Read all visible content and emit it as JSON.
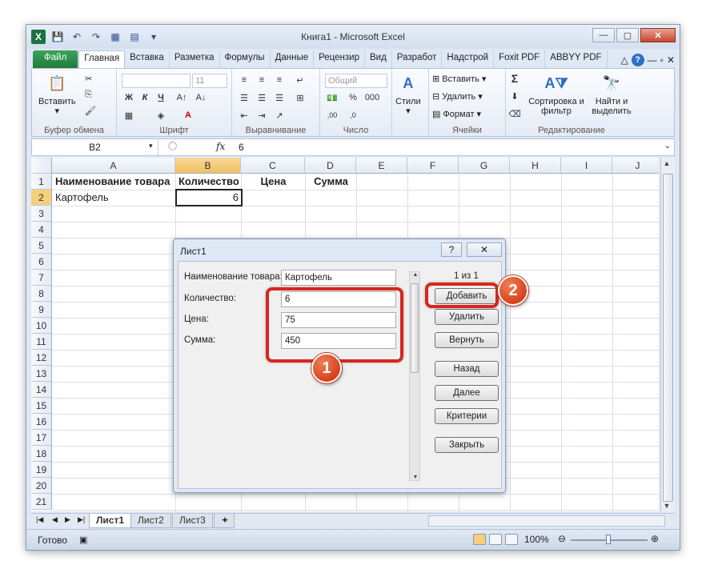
{
  "window": {
    "title": "Книга1 - Microsoft Excel",
    "controls": [
      "—",
      "▢",
      "✕"
    ]
  },
  "ribbon": {
    "tabs": [
      "Файл",
      "Главная",
      "Вставка",
      "Разметка",
      "Формулы",
      "Данные",
      "Рецензир",
      "Вид",
      "Разработ",
      "Надстрой",
      "Foxit PDF",
      "ABBYY PDF"
    ],
    "active_tab": "Главная",
    "groups": {
      "clipboard": {
        "label": "Буфер обмена",
        "paste": "Вставить"
      },
      "font": {
        "label": "Шрифт",
        "size": "11",
        "bold": "Ж",
        "italic": "К",
        "underline": "Ч"
      },
      "alignment": {
        "label": "Выравнивание"
      },
      "number": {
        "label": "Число",
        "format": "Общий"
      },
      "styles": {
        "label": "Стили"
      },
      "cells": {
        "label": "Ячейки",
        "insert": "Вставить",
        "delete": "Удалить",
        "format": "Формат"
      },
      "editing": {
        "label": "Редактирование",
        "sort_filter": "Сортировка и фильтр",
        "find_select": "Найти и выделить",
        "sum": "Σ"
      }
    }
  },
  "formula_bar": {
    "name_box": "B2",
    "fx": "fx",
    "value": "6"
  },
  "sheet": {
    "columns": [
      "A",
      "B",
      "C",
      "D",
      "E",
      "F",
      "G",
      "H",
      "I",
      "J"
    ],
    "selected_column": "B",
    "rows": [
      "1",
      "2",
      "3",
      "4",
      "5",
      "6",
      "7",
      "8",
      "9",
      "10",
      "11",
      "12",
      "13",
      "14",
      "15",
      "16",
      "17",
      "18",
      "19",
      "20",
      "21"
    ],
    "selected_row": "2",
    "cells": {
      "A1": "Наименование товара",
      "B1": "Количество",
      "C1": "Цена",
      "D1": "Сумма",
      "A2": "Картофель",
      "B2": "6"
    }
  },
  "sheet_tabs": [
    "Лист1",
    "Лист2",
    "Лист3"
  ],
  "status_bar": {
    "status": "Готово",
    "zoom": "100%",
    "zoom_level": 1.0
  },
  "dialog": {
    "title": "Лист1",
    "help": "?",
    "close": "✕",
    "record_counter": "1 из 1",
    "fields": [
      {
        "label": "Наименование товара:",
        "value": "Картофель"
      },
      {
        "label": "Количество:",
        "value": "6"
      },
      {
        "label": "Цена:",
        "value": "75"
      },
      {
        "label": "Сумма:",
        "value": "450"
      }
    ],
    "buttons": [
      "Добавить",
      "Удалить",
      "Вернуть",
      "Назад",
      "Далее",
      "Критерии",
      "Закрыть"
    ]
  },
  "annotations": {
    "callout_1": "1",
    "callout_2": "2",
    "color": "#d9261c"
  }
}
